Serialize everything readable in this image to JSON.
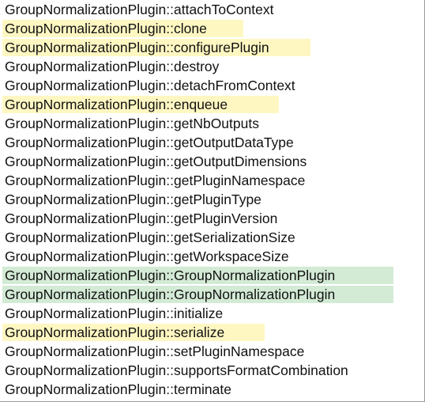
{
  "colors": {
    "highlight_yellow": "#fff7c2",
    "highlight_green": "#d3ead5",
    "text": "#111111",
    "background": "#ffffff"
  },
  "items": [
    {
      "text": "GroupNormalizationPlugin::attachToContext",
      "highlight": "none"
    },
    {
      "text": "GroupNormalizationPlugin::clone",
      "highlight": "yellow"
    },
    {
      "text": "GroupNormalizationPlugin::configurePlugin",
      "highlight": "yellow"
    },
    {
      "text": "GroupNormalizationPlugin::destroy",
      "highlight": "none"
    },
    {
      "text": "GroupNormalizationPlugin::detachFromContext",
      "highlight": "none"
    },
    {
      "text": "GroupNormalizationPlugin::enqueue",
      "highlight": "yellow"
    },
    {
      "text": "GroupNormalizationPlugin::getNbOutputs",
      "highlight": "none"
    },
    {
      "text": "GroupNormalizationPlugin::getOutputDataType",
      "highlight": "none"
    },
    {
      "text": "GroupNormalizationPlugin::getOutputDimensions",
      "highlight": "none"
    },
    {
      "text": "GroupNormalizationPlugin::getPluginNamespace",
      "highlight": "none"
    },
    {
      "text": "GroupNormalizationPlugin::getPluginType",
      "highlight": "none"
    },
    {
      "text": "GroupNormalizationPlugin::getPluginVersion",
      "highlight": "none"
    },
    {
      "text": "GroupNormalizationPlugin::getSerializationSize",
      "highlight": "none"
    },
    {
      "text": "GroupNormalizationPlugin::getWorkspaceSize",
      "highlight": "none"
    },
    {
      "text": "GroupNormalizationPlugin::GroupNormalizationPlugin",
      "highlight": "green"
    },
    {
      "text": "GroupNormalizationPlugin::GroupNormalizationPlugin",
      "highlight": "green"
    },
    {
      "text": "GroupNormalizationPlugin::initialize",
      "highlight": "none"
    },
    {
      "text": "GroupNormalizationPlugin::serialize",
      "highlight": "yellow"
    },
    {
      "text": "GroupNormalizationPlugin::setPluginNamespace",
      "highlight": "none"
    },
    {
      "text": "GroupNormalizationPlugin::supportsFormatCombination",
      "highlight": "none"
    },
    {
      "text": "GroupNormalizationPlugin::terminate",
      "highlight": "none"
    }
  ]
}
